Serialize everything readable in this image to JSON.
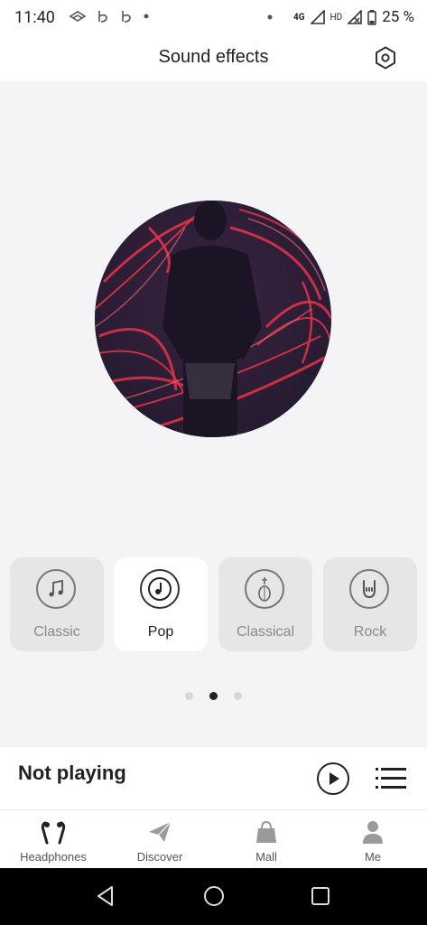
{
  "status_bar": {
    "time": "11:40",
    "network": "4G",
    "hd": "HD",
    "battery": "25 %"
  },
  "header": {
    "title": "Sound effects",
    "settings_icon": "settings-hexagon-icon"
  },
  "effects": [
    {
      "label": "Classic",
      "icon": "music-note-icon",
      "active": false
    },
    {
      "label": "Pop",
      "icon": "vinyl-note-icon",
      "active": true
    },
    {
      "label": "Classical",
      "icon": "lute-icon",
      "active": false
    },
    {
      "label": "Rock",
      "icon": "rock-hand-icon",
      "active": false
    }
  ],
  "pager": {
    "count": 3,
    "active_index": 1
  },
  "player": {
    "status": "Not playing"
  },
  "tabs": [
    {
      "label": "Headphones",
      "icon": "earbuds-icon"
    },
    {
      "label": "Discover",
      "icon": "paper-plane-icon"
    },
    {
      "label": "Mall",
      "icon": "shopping-bag-icon"
    },
    {
      "label": "Me",
      "icon": "person-icon"
    }
  ],
  "colors": {
    "background": "#f4f4f6",
    "card": "#e6e6e8",
    "card_active": "#ffffff",
    "text_primary": "#222222",
    "text_muted": "#8a8a8a",
    "album_red": "#e8324a"
  }
}
